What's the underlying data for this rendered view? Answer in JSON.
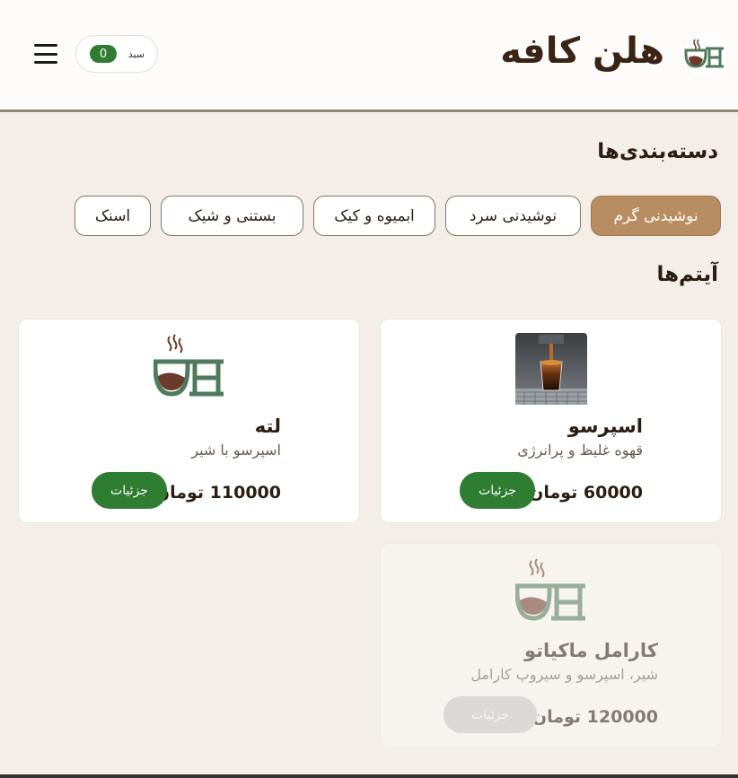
{
  "header": {
    "brand_name": "هلن کافه",
    "cart_label": "سبد",
    "cart_count": "0"
  },
  "categories": {
    "title": "دسته‌بندی‌ها",
    "items": [
      {
        "label": "نوشیدنی گرم",
        "active": true
      },
      {
        "label": "نوشیدنی سرد",
        "active": false
      },
      {
        "label": "ابمیوه و کیک",
        "active": false
      },
      {
        "label": "بستنی و شیک",
        "active": false
      },
      {
        "label": "اسنک",
        "active": false
      }
    ]
  },
  "items": {
    "title": "آیتم‌ها",
    "list": [
      {
        "name": "اسپرسو",
        "description": "قهوه غلیظ و پرانرژی",
        "price": "60000 تومان",
        "button": "جزئیات",
        "image": "espresso-photo"
      },
      {
        "name": "لته",
        "description": "اسپرسو با شیر",
        "price": "110000 تومان",
        "button": "جزئیات",
        "image": "cafe-logo"
      },
      {
        "name": "کارامل ماکیاتو",
        "description": "شیر، اسپرسو و سیروپ کارامل",
        "price": "120000 تومان",
        "button": "جزئیات",
        "image": "cafe-logo"
      }
    ]
  },
  "colors": {
    "accent": "#b88d62",
    "button_green": "#2e7d32",
    "background": "#f3eee8"
  }
}
